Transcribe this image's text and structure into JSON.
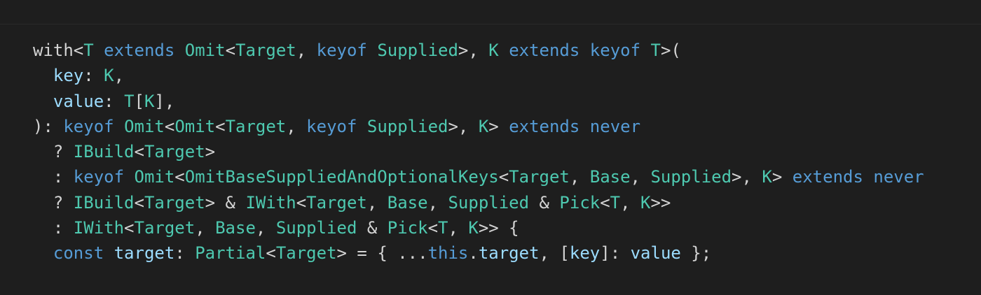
{
  "editor": {
    "language": "typescript",
    "background": "#1e1e1e",
    "colors": {
      "keyword": "#569cd6",
      "type": "#4ec9b0",
      "identifier": "#9cdcfe",
      "punctuation": "#d4d4d4"
    },
    "lines": [
      [
        {
          "t": "with",
          "c": "pl"
        },
        {
          "t": "<",
          "c": "pl"
        },
        {
          "t": "T",
          "c": "ty"
        },
        {
          "t": " ",
          "c": "pl"
        },
        {
          "t": "extends",
          "c": "kw"
        },
        {
          "t": " ",
          "c": "pl"
        },
        {
          "t": "Omit",
          "c": "ty"
        },
        {
          "t": "<",
          "c": "pl"
        },
        {
          "t": "Target",
          "c": "ty"
        },
        {
          "t": ", ",
          "c": "pl"
        },
        {
          "t": "keyof",
          "c": "kw"
        },
        {
          "t": " ",
          "c": "pl"
        },
        {
          "t": "Supplied",
          "c": "ty"
        },
        {
          "t": ">, ",
          "c": "pl"
        },
        {
          "t": "K",
          "c": "ty"
        },
        {
          "t": " ",
          "c": "pl"
        },
        {
          "t": "extends",
          "c": "kw"
        },
        {
          "t": " ",
          "c": "pl"
        },
        {
          "t": "keyof",
          "c": "kw"
        },
        {
          "t": " ",
          "c": "pl"
        },
        {
          "t": "T",
          "c": "ty"
        },
        {
          "t": ">(",
          "c": "pl"
        }
      ],
      [
        {
          "t": "  ",
          "c": "pl"
        },
        {
          "t": "key",
          "c": "id"
        },
        {
          "t": ": ",
          "c": "pl"
        },
        {
          "t": "K",
          "c": "ty"
        },
        {
          "t": ",",
          "c": "pl"
        }
      ],
      [
        {
          "t": "  ",
          "c": "pl"
        },
        {
          "t": "value",
          "c": "id"
        },
        {
          "t": ": ",
          "c": "pl"
        },
        {
          "t": "T",
          "c": "ty"
        },
        {
          "t": "[",
          "c": "pl"
        },
        {
          "t": "K",
          "c": "ty"
        },
        {
          "t": "],",
          "c": "pl"
        }
      ],
      [
        {
          "t": "): ",
          "c": "pl"
        },
        {
          "t": "keyof",
          "c": "kw"
        },
        {
          "t": " ",
          "c": "pl"
        },
        {
          "t": "Omit",
          "c": "ty"
        },
        {
          "t": "<",
          "c": "pl"
        },
        {
          "t": "Omit",
          "c": "ty"
        },
        {
          "t": "<",
          "c": "pl"
        },
        {
          "t": "Target",
          "c": "ty"
        },
        {
          "t": ", ",
          "c": "pl"
        },
        {
          "t": "keyof",
          "c": "kw"
        },
        {
          "t": " ",
          "c": "pl"
        },
        {
          "t": "Supplied",
          "c": "ty"
        },
        {
          "t": ">, ",
          "c": "pl"
        },
        {
          "t": "K",
          "c": "ty"
        },
        {
          "t": "> ",
          "c": "pl"
        },
        {
          "t": "extends",
          "c": "kw"
        },
        {
          "t": " ",
          "c": "pl"
        },
        {
          "t": "never",
          "c": "kw"
        }
      ],
      [
        {
          "t": "  ? ",
          "c": "pl"
        },
        {
          "t": "IBuild",
          "c": "ty"
        },
        {
          "t": "<",
          "c": "pl"
        },
        {
          "t": "Target",
          "c": "ty"
        },
        {
          "t": ">",
          "c": "pl"
        }
      ],
      [
        {
          "t": "  : ",
          "c": "pl"
        },
        {
          "t": "keyof",
          "c": "kw"
        },
        {
          "t": " ",
          "c": "pl"
        },
        {
          "t": "Omit",
          "c": "ty"
        },
        {
          "t": "<",
          "c": "pl"
        },
        {
          "t": "OmitBaseSuppliedAndOptionalKeys",
          "c": "ty"
        },
        {
          "t": "<",
          "c": "pl"
        },
        {
          "t": "Target",
          "c": "ty"
        },
        {
          "t": ", ",
          "c": "pl"
        },
        {
          "t": "Base",
          "c": "ty"
        },
        {
          "t": ", ",
          "c": "pl"
        },
        {
          "t": "Supplied",
          "c": "ty"
        },
        {
          "t": ">, ",
          "c": "pl"
        },
        {
          "t": "K",
          "c": "ty"
        },
        {
          "t": "> ",
          "c": "pl"
        },
        {
          "t": "extends",
          "c": "kw"
        },
        {
          "t": " ",
          "c": "pl"
        },
        {
          "t": "never",
          "c": "kw"
        }
      ],
      [
        {
          "t": "  ? ",
          "c": "pl"
        },
        {
          "t": "IBuild",
          "c": "ty"
        },
        {
          "t": "<",
          "c": "pl"
        },
        {
          "t": "Target",
          "c": "ty"
        },
        {
          "t": "> & ",
          "c": "pl"
        },
        {
          "t": "IWith",
          "c": "ty"
        },
        {
          "t": "<",
          "c": "pl"
        },
        {
          "t": "Target",
          "c": "ty"
        },
        {
          "t": ", ",
          "c": "pl"
        },
        {
          "t": "Base",
          "c": "ty"
        },
        {
          "t": ", ",
          "c": "pl"
        },
        {
          "t": "Supplied",
          "c": "ty"
        },
        {
          "t": " & ",
          "c": "pl"
        },
        {
          "t": "Pick",
          "c": "ty"
        },
        {
          "t": "<",
          "c": "pl"
        },
        {
          "t": "T",
          "c": "ty"
        },
        {
          "t": ", ",
          "c": "pl"
        },
        {
          "t": "K",
          "c": "ty"
        },
        {
          "t": ">>",
          "c": "pl"
        }
      ],
      [
        {
          "t": "  : ",
          "c": "pl"
        },
        {
          "t": "IWith",
          "c": "ty"
        },
        {
          "t": "<",
          "c": "pl"
        },
        {
          "t": "Target",
          "c": "ty"
        },
        {
          "t": ", ",
          "c": "pl"
        },
        {
          "t": "Base",
          "c": "ty"
        },
        {
          "t": ", ",
          "c": "pl"
        },
        {
          "t": "Supplied",
          "c": "ty"
        },
        {
          "t": " & ",
          "c": "pl"
        },
        {
          "t": "Pick",
          "c": "ty"
        },
        {
          "t": "<",
          "c": "pl"
        },
        {
          "t": "T",
          "c": "ty"
        },
        {
          "t": ", ",
          "c": "pl"
        },
        {
          "t": "K",
          "c": "ty"
        },
        {
          "t": ">> {",
          "c": "pl"
        }
      ],
      [
        {
          "t": "  ",
          "c": "pl"
        },
        {
          "t": "const",
          "c": "kw"
        },
        {
          "t": " ",
          "c": "pl"
        },
        {
          "t": "target",
          "c": "id"
        },
        {
          "t": ": ",
          "c": "pl"
        },
        {
          "t": "Partial",
          "c": "ty"
        },
        {
          "t": "<",
          "c": "pl"
        },
        {
          "t": "Target",
          "c": "ty"
        },
        {
          "t": "> = { ...",
          "c": "pl"
        },
        {
          "t": "this",
          "c": "kw"
        },
        {
          "t": ".",
          "c": "pl"
        },
        {
          "t": "target",
          "c": "id"
        },
        {
          "t": ", [",
          "c": "pl"
        },
        {
          "t": "key",
          "c": "id"
        },
        {
          "t": "]: ",
          "c": "pl"
        },
        {
          "t": "value",
          "c": "id"
        },
        {
          "t": " };",
          "c": "pl"
        }
      ]
    ]
  }
}
